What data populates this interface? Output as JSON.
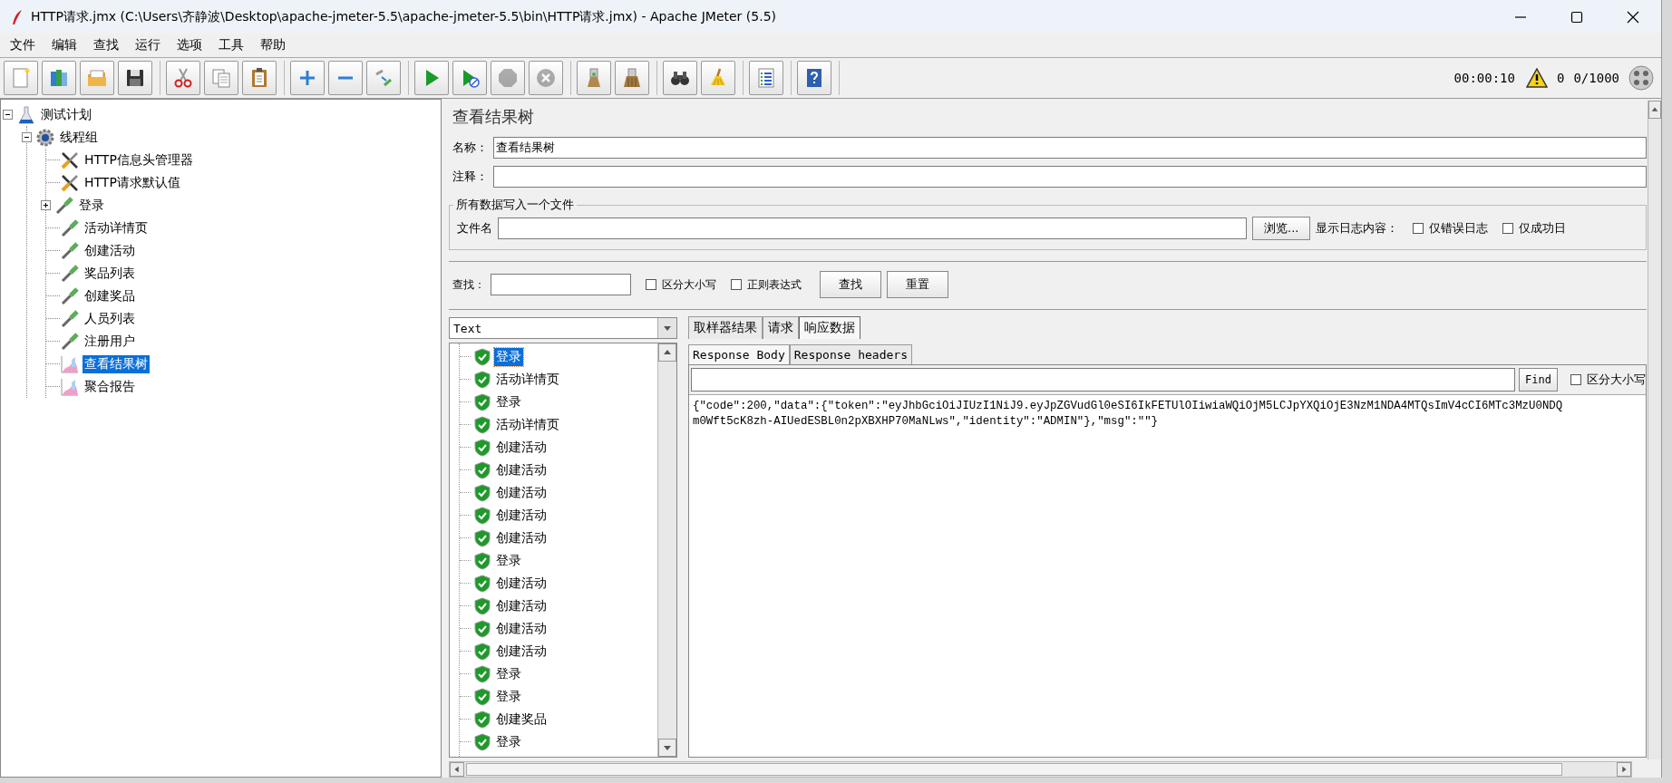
{
  "window": {
    "title": "HTTP请求.jmx (C:\\Users\\齐静波\\Desktop\\apache-jmeter-5.5\\apache-jmeter-5.5\\bin\\HTTP请求.jmx) - Apache JMeter (5.5)"
  },
  "menu": [
    "文件",
    "编辑",
    "查找",
    "运行",
    "选项",
    "工具",
    "帮助"
  ],
  "toolbar_groups": [
    [
      {
        "kind": "new",
        "disabled": false
      },
      {
        "kind": "templates",
        "disabled": false
      },
      {
        "kind": "open",
        "disabled": false
      },
      {
        "kind": "save",
        "disabled": false
      }
    ],
    [
      {
        "kind": "cut",
        "disabled": false
      },
      {
        "kind": "copy",
        "disabled": false
      },
      {
        "kind": "paste",
        "disabled": false
      }
    ],
    [
      {
        "kind": "expand",
        "disabled": false
      },
      {
        "kind": "collapse",
        "disabled": false
      },
      {
        "kind": "toggle",
        "disabled": false
      }
    ],
    [
      {
        "kind": "start",
        "disabled": false
      },
      {
        "kind": "start-no-pause",
        "disabled": false
      },
      {
        "kind": "stop",
        "disabled": true
      },
      {
        "kind": "shutdown",
        "disabled": true
      }
    ],
    [
      {
        "kind": "clear",
        "disabled": false
      },
      {
        "kind": "clear-all",
        "disabled": false
      }
    ],
    [
      {
        "kind": "search",
        "disabled": false
      },
      {
        "kind": "reset-search",
        "disabled": false
      }
    ],
    [
      {
        "kind": "function-helper",
        "disabled": false
      }
    ],
    [
      {
        "kind": "help",
        "disabled": false
      }
    ]
  ],
  "status": {
    "elapsed": "00:00:10",
    "errors": "0",
    "threads": "0/1000"
  },
  "tree": [
    {
      "label": "测试计划",
      "kind": "plan",
      "expanded": true,
      "selected": false,
      "children": [
        {
          "label": "线程组",
          "kind": "thread-group",
          "expanded": true,
          "selected": false,
          "children": [
            {
              "label": "HTTP信息头管理器",
              "kind": "config",
              "selected": false
            },
            {
              "label": "HTTP请求默认值",
              "kind": "config",
              "selected": false
            },
            {
              "label": "登录",
              "kind": "sampler",
              "expanded": false,
              "selected": false
            },
            {
              "label": "活动详情页",
              "kind": "sampler",
              "selected": false
            },
            {
              "label": "创建活动",
              "kind": "sampler",
              "selected": false
            },
            {
              "label": "奖品列表",
              "kind": "sampler",
              "selected": false
            },
            {
              "label": "创建奖品",
              "kind": "sampler",
              "selected": false
            },
            {
              "label": "人员列表",
              "kind": "sampler",
              "selected": false
            },
            {
              "label": "注册用户",
              "kind": "sampler",
              "selected": false
            },
            {
              "label": "查看结果树",
              "kind": "listener",
              "selected": true
            },
            {
              "label": "聚合报告",
              "kind": "listener",
              "selected": false
            }
          ]
        }
      ]
    }
  ],
  "panel": {
    "title": "查看结果树",
    "name_label": "名称：",
    "name_value": "查看结果树",
    "comment_label": "注释：",
    "file_group": "所有数据写入一个文件",
    "file_label": "文件名",
    "browse_button": "浏览...",
    "log_label": "显示日志内容：",
    "log_options": [
      {
        "label": "仅错误日志",
        "checked": false
      },
      {
        "label": "仅成功日",
        "checked": false
      }
    ]
  },
  "search": {
    "label": "查找：",
    "options": [
      {
        "label": "区分大小写",
        "checked": false
      },
      {
        "label": "正则表达式",
        "checked": false
      }
    ],
    "buttons": [
      "查找",
      "重置"
    ]
  },
  "renderer": {
    "value": "Text"
  },
  "results": [
    {
      "label": "登录",
      "success": true,
      "selected": true
    },
    {
      "label": "活动详情页",
      "success": true,
      "selected": false
    },
    {
      "label": "登录",
      "success": true,
      "selected": false
    },
    {
      "label": "活动详情页",
      "success": true,
      "selected": false
    },
    {
      "label": "创建活动",
      "success": true,
      "selected": false
    },
    {
      "label": "创建活动",
      "success": true,
      "selected": false
    },
    {
      "label": "创建活动",
      "success": true,
      "selected": false
    },
    {
      "label": "创建活动",
      "success": true,
      "selected": false
    },
    {
      "label": "创建活动",
      "success": true,
      "selected": false
    },
    {
      "label": "登录",
      "success": true,
      "selected": false
    },
    {
      "label": "创建活动",
      "success": true,
      "selected": false
    },
    {
      "label": "创建活动",
      "success": true,
      "selected": false
    },
    {
      "label": "创建活动",
      "success": true,
      "selected": false
    },
    {
      "label": "创建活动",
      "success": true,
      "selected": false
    },
    {
      "label": "登录",
      "success": true,
      "selected": false
    },
    {
      "label": "登录",
      "success": true,
      "selected": false
    },
    {
      "label": "创建奖品",
      "success": true,
      "selected": false
    },
    {
      "label": "登录",
      "success": true,
      "selected": false
    }
  ],
  "tabs": [
    {
      "label": "取样器结果",
      "selected": false
    },
    {
      "label": "请求",
      "selected": false
    },
    {
      "label": "响应数据",
      "selected": true
    }
  ],
  "subtabs": [
    {
      "label": "Response Body",
      "selected": true
    },
    {
      "label": "Response headers",
      "selected": false
    }
  ],
  "find": {
    "button": "Find",
    "options": [
      {
        "label": "区分大小写",
        "checked": false
      }
    ]
  },
  "response_lines": [
    "{\"code\":200,\"data\":{\"token\":\"eyJhbGciOiJIUzI1NiJ9.eyJpZGVudGl0eSI6IkFETUlOIiwiaWQiOjM5LCJpYXQiOjE3NzM1NDA4MTQsImV4cCI6MTc3MzU0NDQ",
    "m0Wft5cK8zh-AIUedESBL0n2pXBXHP70MaNLws\",\"identity\":\"ADMIN\"},\"msg\":\"\"}"
  ]
}
